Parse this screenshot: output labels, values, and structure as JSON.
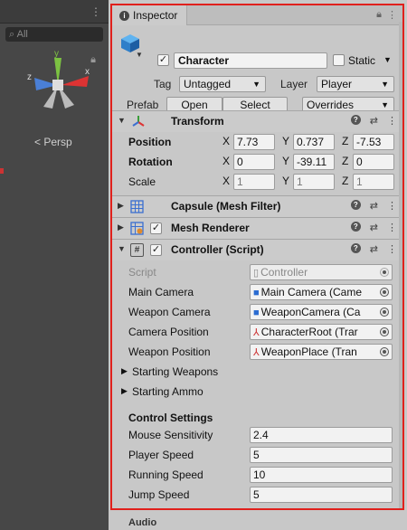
{
  "scene": {
    "search_placeholder": "All",
    "camera_label": "< Persp",
    "axis_labels": {
      "y": "y",
      "z": "z",
      "x": "x"
    }
  },
  "inspector": {
    "tab_label": "Inspector",
    "gameobject": {
      "active": true,
      "name": "Character",
      "static_label": "Static",
      "static_checked": false,
      "tag_label": "Tag",
      "tag_value": "Untagged",
      "layer_label": "Layer",
      "layer_value": "Player",
      "prefab_label": "Prefab",
      "open_label": "Open",
      "select_label": "Select",
      "overrides_label": "Overrides"
    },
    "transform": {
      "title": "Transform",
      "position_label": "Position",
      "rotation_label": "Rotation",
      "scale_label": "Scale",
      "x_label": "X",
      "y_label": "Y",
      "z_label": "Z",
      "position": {
        "x": "7.73",
        "y": "0.737",
        "z": "-7.53"
      },
      "rotation": {
        "x": "0",
        "y": "-39.11",
        "z": "0"
      },
      "scale": {
        "x": "1",
        "y": "1",
        "z": "1"
      }
    },
    "mesh_filter": {
      "title": "Capsule (Mesh Filter)"
    },
    "mesh_renderer": {
      "title": "Mesh Renderer",
      "enabled": true
    },
    "controller": {
      "title": "Controller (Script)",
      "enabled": true,
      "script_label": "Script",
      "script_value": "Controller",
      "main_camera_label": "Main Camera",
      "main_camera_value": "Main Camera (Came",
      "weapon_camera_label": "Weapon Camera",
      "weapon_camera_value": "WeaponCamera (Ca",
      "camera_position_label": "Camera Position",
      "camera_position_value": "CharacterRoot (Trar",
      "weapon_position_label": "Weapon Position",
      "weapon_position_value": "WeaponPlace (Tran",
      "starting_weapons_label": "Starting Weapons",
      "starting_ammo_label": "Starting Ammo",
      "control_settings_label": "Control Settings",
      "mouse_sensitivity_label": "Mouse Sensitivity",
      "mouse_sensitivity_value": "2.4",
      "player_speed_label": "Player Speed",
      "player_speed_value": "5",
      "running_speed_label": "Running Speed",
      "running_speed_value": "10",
      "jump_speed_label": "Jump Speed",
      "jump_speed_value": "5"
    },
    "next_component_label": "Audio"
  },
  "colors": {
    "highlight_border": "#e0201c",
    "panel_bg": "#c8c8c8",
    "scene_bg": "#474747"
  }
}
